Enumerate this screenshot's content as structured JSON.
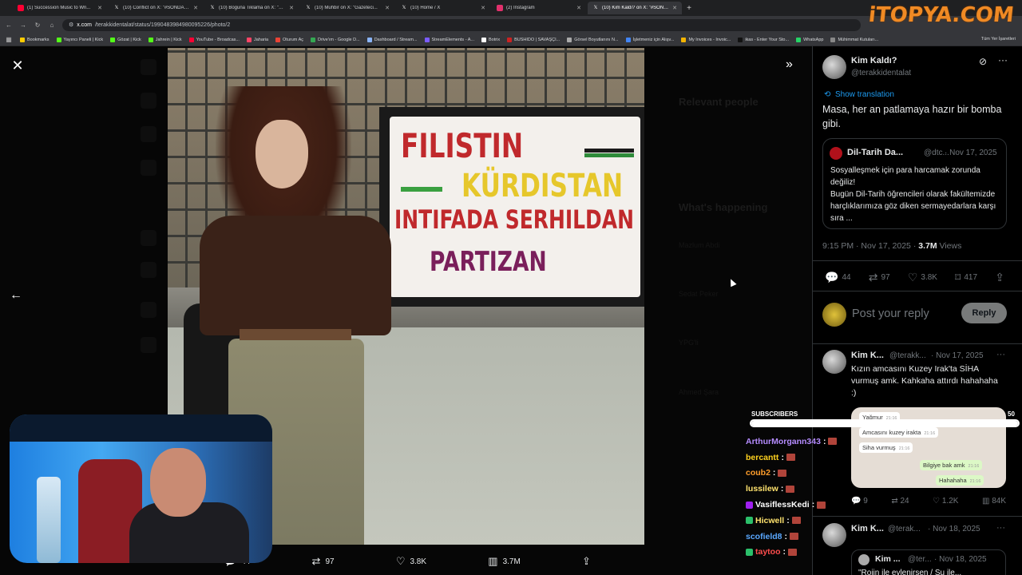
{
  "browser": {
    "tabs": [
      {
        "label": "(1) Succession Music to Wri...",
        "icon_color": "#ff0033",
        "active": false
      },
      {
        "label": "(10) Conflict on X: \"#SONDAKI...",
        "icon_color": "#ffffff",
        "active": false
      },
      {
        "label": "(10) Boguna Tiklama on X: \"Tru...",
        "icon_color": "#ffffff",
        "active": false
      },
      {
        "label": "(10) Muhbir on X: \"Gazeteci...",
        "icon_color": "#ffffff",
        "active": false
      },
      {
        "label": "(10) Home / X",
        "icon_color": "#ffffff",
        "active": false
      },
      {
        "label": "(2) Instagram",
        "icon_color": "#e1306c",
        "active": false
      },
      {
        "label": "(10) Kim Kaldı? on X: \"#SONDAK...",
        "icon_color": "#ffffff",
        "active": true
      }
    ],
    "url_host": "x.com",
    "url_path": "/terakkidentalat/status/1990483984980095226/photo/2",
    "bookmarks": [
      {
        "label": "Bookmarks",
        "color": "#ffcc00"
      },
      {
        "label": "Yayıncı Paneli | Kick",
        "color": "#53fc18"
      },
      {
        "label": "Gözat | Kick",
        "color": "#53fc18"
      },
      {
        "label": "Jahrein | Kick",
        "color": "#53fc18"
      },
      {
        "label": "YouTube - Broadcas...",
        "color": "#ff0033"
      },
      {
        "label": "Jaharia",
        "color": "#ff4466"
      },
      {
        "label": "Oturum Aç",
        "color": "#ea4335"
      },
      {
        "label": "Drive'ım - Google D...",
        "color": "#34a853"
      },
      {
        "label": "Dashboard / Stream...",
        "color": "#8ab4f8"
      },
      {
        "label": "StreamElements - A...",
        "color": "#7b5cff"
      },
      {
        "label": "Botrix",
        "color": "#ffffff"
      },
      {
        "label": "BUSHIDO | SAVAŞÇI...",
        "color": "#cc2222"
      },
      {
        "label": "Görsel Boyutlanını N...",
        "color": "#aaaaaa"
      },
      {
        "label": "İşletmeniz için Alışv...",
        "color": "#4285f4"
      },
      {
        "label": "My Invoices - Invoic...",
        "color": "#f4b400"
      },
      {
        "label": "ikas - Enter Your Sto...",
        "color": "#111111"
      },
      {
        "label": "WhatsApp",
        "color": "#25d366"
      },
      {
        "label": "Mühimmat Kutuları...",
        "color": "#888888"
      }
    ],
    "all_bookmarks_label": "Tüm Yer İşaretleri"
  },
  "watermark": "iTOPYA.COM",
  "viewer": {
    "poster_lines": [
      "FILISTIN",
      "KÜRDISTAN",
      "INTIFADA SERHILDAN",
      "PARTIZAN"
    ],
    "background_ghost": {
      "relevant_people": "Relevant people",
      "whats_happening": "What's happening",
      "trend1": "Mazlum Abdi",
      "trend2": "Sedat Peker",
      "trend3": "YPG'li",
      "trend4": "Ahmed Şara"
    },
    "actions": {
      "replies": "44",
      "reposts": "97",
      "likes": "3.8K",
      "views": "3.7M"
    }
  },
  "tweet": {
    "author_name": "Kim Kaldı?",
    "author_handle": "@terakkidentalat",
    "show_translation": "Show translation",
    "text": "Masa, her an patlamaya hazır bir bomba gibi.",
    "quote": {
      "author_name": "Dil-Tarih Da...",
      "author_handle": "@dtc...",
      "date": "· Nov 17, 2025",
      "text": "Sosyalleşmek için para harcamak zorunda değiliz!\nBugün Dil-Tarih öğrencileri olarak fakültemizde harçlıklarımıza göz diken sermayedarlara karşı sıra ..."
    },
    "timestamp": "9:15 PM · Nov 17, 2025 · ",
    "views_count": "3.7M",
    "views_label": " Views",
    "stats": {
      "replies": "44",
      "reposts": "97",
      "likes": "3.8K",
      "bookmarks": "417"
    },
    "reply_placeholder": "Post your reply",
    "reply_button": "Reply"
  },
  "replies": [
    {
      "author_name": "Kim K...",
      "author_handle": "@terakk...",
      "date": "· Nov 17, 2025",
      "text": "Kızın amcasını Kuzey Irak'ta SİHA vurmuş amk. Kahkaha attırdı hahahaha :)",
      "chat": [
        {
          "text": "Yağmur",
          "time": "21:16",
          "dir": "in"
        },
        {
          "text": "Amcasını kuzey irakta",
          "time": "21:16",
          "dir": "in"
        },
        {
          "text": "Siha vurmuş",
          "time": "21:16",
          "dir": "in"
        },
        {
          "text": "Bilgiye bak amk",
          "time": "21:16",
          "dir": "out"
        },
        {
          "text": "Hahahaha",
          "time": "21:16",
          "dir": "out"
        }
      ],
      "stats": {
        "replies": "9",
        "reposts": "24",
        "likes": "1.2K",
        "views": "84K"
      }
    },
    {
      "author_name": "Kim K...",
      "author_handle": "@terak...",
      "date": "· Nov 18, 2025",
      "quote_author": "Kim ...",
      "quote_handle": "@ter...",
      "quote_date": "· Nov 18, 2025",
      "quote_text": "\"Rojin ile evlenirsen / Su ile..."
    }
  ],
  "overlay": {
    "subs_label": "SUBSCRIBERS",
    "subs_count": "50",
    "subs_progress": 1.0,
    "chat": [
      {
        "user": "ArthurMorgann343",
        "color": "#b58cff",
        "badge": ""
      },
      {
        "user": "bercantt",
        "color": "#ffd21f",
        "badge": ""
      },
      {
        "user": "coub2",
        "color": "#ff9e2c",
        "badge": ""
      },
      {
        "user": "lussilew",
        "color": "#ffe36e",
        "badge": ""
      },
      {
        "user": "VasiflessKedi",
        "color": "#ffffff",
        "badge": "#a020f0"
      },
      {
        "user": "Hicwell",
        "color": "#ffe36e",
        "badge": "#2bbf6a"
      },
      {
        "user": "scofield8",
        "color": "#5aa8ff",
        "badge": ""
      },
      {
        "user": "taytoo",
        "color": "#ff4d4d",
        "badge": "#2bbf6a"
      }
    ]
  }
}
